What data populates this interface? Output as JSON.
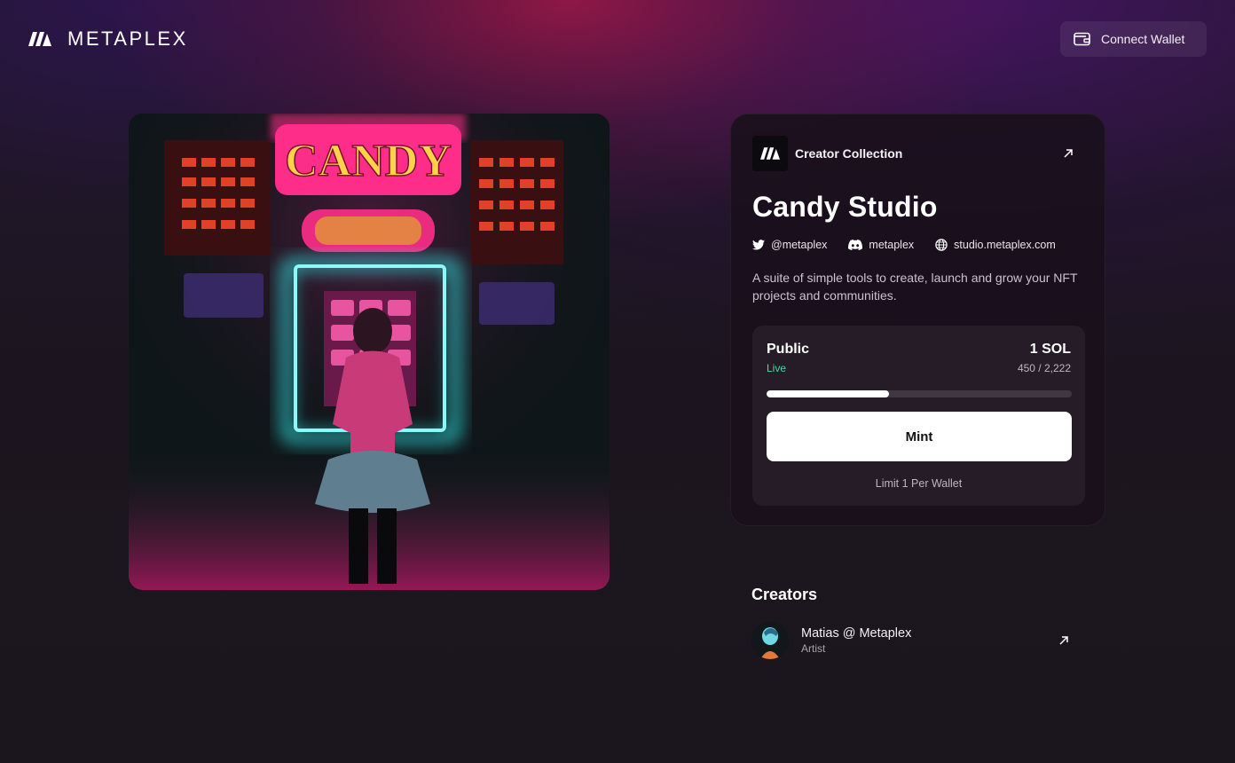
{
  "header": {
    "brand": "METAPLEX",
    "connect_label": "Connect Wallet"
  },
  "collection": {
    "label": "Creator Collection",
    "title": "Candy Studio",
    "socials": [
      {
        "icon": "twitter-icon",
        "label": "@metaplex"
      },
      {
        "icon": "discord-icon",
        "label": "metaplex"
      },
      {
        "icon": "globe-icon",
        "label": "studio.metaplex.com"
      }
    ],
    "description": "A suite of simple tools to create, launch and grow your NFT projects and communities."
  },
  "mint": {
    "phase": "Public",
    "status": "Live",
    "price": "1 SOL",
    "supply": "450 / 2,222",
    "progress_fraction": 0.4,
    "button_label": "Mint",
    "limit": "Limit 1 Per Wallet"
  },
  "creators": {
    "title": "Creators",
    "items": [
      {
        "name": "Matias @ Metaplex",
        "role": "Artist"
      }
    ]
  },
  "hero_image": {
    "sign_text": "CANDY"
  },
  "colors": {
    "accent_live": "#35e0a1",
    "neon_pink": "#ff2d8a",
    "neon_cyan": "#2ee6e6"
  }
}
